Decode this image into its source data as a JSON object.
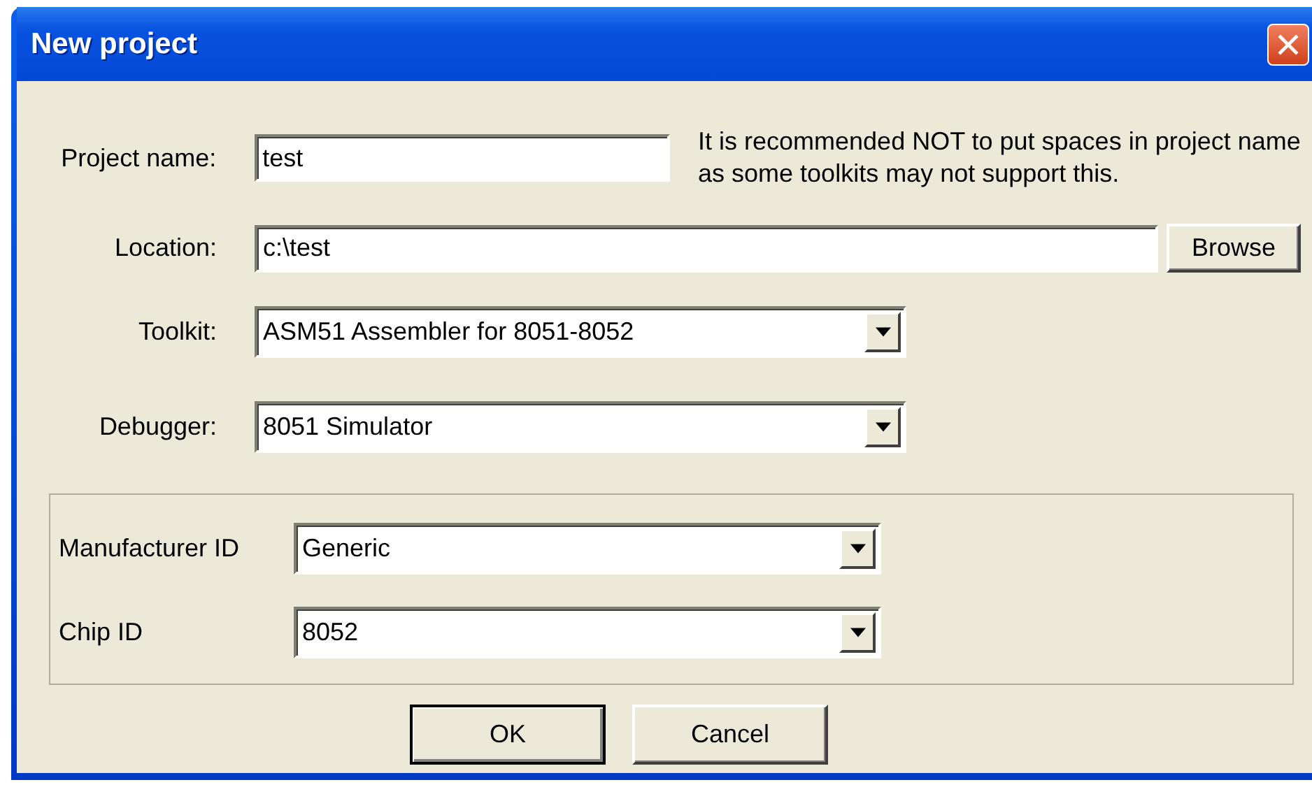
{
  "window": {
    "title": "New project"
  },
  "project_name": {
    "label": "Project name:",
    "value": "test"
  },
  "hint": "It is recommended NOT to put spaces in project name as some toolkits may not support this.",
  "location": {
    "label": "Location:",
    "value": "c:\\test"
  },
  "browse_button": "Browse",
  "toolkit": {
    "label": "Toolkit:",
    "value": "ASM51 Assembler for 8051-8052"
  },
  "debugger": {
    "label": "Debugger:",
    "value": "8051 Simulator"
  },
  "device_group": [
    {
      "label": "Manufacturer ID",
      "value": "Generic"
    },
    {
      "label": "Chip ID",
      "value": "8052"
    }
  ],
  "buttons": [
    {
      "label": "OK",
      "default": true
    },
    {
      "label": "Cancel",
      "default": false
    }
  ]
}
